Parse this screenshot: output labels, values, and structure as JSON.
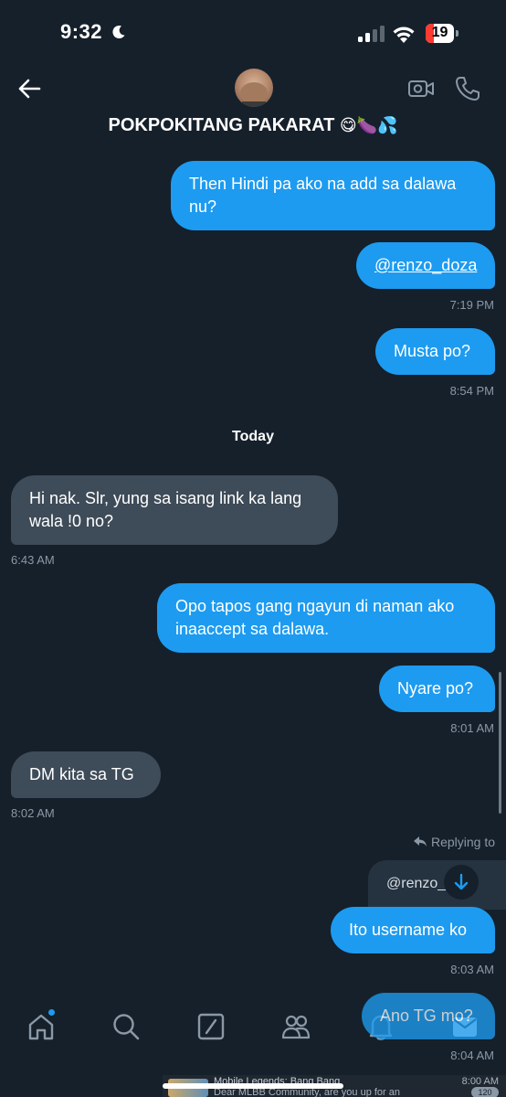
{
  "status_bar": {
    "time": "9:32",
    "battery_level": "19",
    "icons": [
      "moon-icon",
      "cellular-signal-icon",
      "wifi-icon",
      "battery-icon"
    ]
  },
  "header": {
    "title": "POKPOKITANG PAKARAT",
    "title_emoji": "😋🍆💦",
    "icons": [
      "back-arrow-icon",
      "avatar",
      "video-call-icon",
      "phone-call-icon"
    ]
  },
  "messages": [
    {
      "text": "Then Hindi pa ako na add sa dalawa nu?",
      "direction": "out"
    },
    {
      "text": "@renzo_doza",
      "direction": "out",
      "timestamp": "7:19 PM"
    },
    {
      "text": "Musta po?",
      "direction": "out",
      "timestamp": "8:54 PM"
    },
    {
      "text": "Hi nak. Slr, yung sa isang link ka lang wala !0 no?",
      "direction": "in",
      "timestamp": "6:43 AM"
    },
    {
      "text": "Opo tapos gang ngayun di naman ako inaaccept sa dalawa.",
      "direction": "out"
    },
    {
      "text": "Nyare po?",
      "direction": "out",
      "timestamp": "8:01 AM"
    },
    {
      "text": "DM kita sa TG",
      "direction": "in",
      "timestamp": "8:02 AM"
    },
    {
      "text": "Ito username ko",
      "direction": "out",
      "timestamp": "8:03 AM"
    },
    {
      "text": "Ano TG mo?",
      "direction": "out",
      "timestamp": "8:04 AM"
    }
  ],
  "date_divider": "Today",
  "reply": {
    "label": "Replying to",
    "preview": "@renzo_"
  },
  "bottom_nav": [
    "home-icon",
    "search-icon",
    "grok-icon",
    "communities-icon",
    "notifications-icon",
    "messages-icon"
  ],
  "notification": {
    "title": "Mobile Legends: Bang Bang",
    "body": "Dear MLBB Community, are you up for an",
    "time": "8:00 AM",
    "badge": "120"
  },
  "colors": {
    "background": "#15202b",
    "outgoing_bubble": "#1d9bf0",
    "incoming_bubble": "#3e4b58",
    "timestamp": "#8b98a5"
  }
}
